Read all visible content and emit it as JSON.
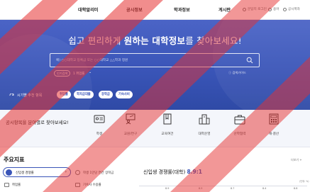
{
  "nav": {
    "items": [
      "대학알리미",
      "공시정보",
      "학과정보",
      "게시판"
    ],
    "utils": [
      "문답지 로그인",
      "용어",
      "공시목차"
    ]
  },
  "hero": {
    "title_pre": "쉽고 편리하게 ",
    "title_bold": "원하는 대학정보",
    "title_post": "를 찾아보세요!",
    "search_placeholder": "예) ○○대학교 등록금 또는 ○○대학교 △△학과 정원",
    "popular_label": "인기검색",
    "popular_rank": "1 취업률",
    "search_guide": "검색가이드",
    "recent_label": "시기별 추천 항목",
    "chips": [
      "취업률",
      "학자금대출",
      "장학금",
      "기숙사비"
    ]
  },
  "categories": {
    "prompt": "공시항목을 분야별로 찾아보세요!",
    "items": [
      "학생",
      "교원/연구",
      "교육여건",
      "대학운영",
      "산학협력",
      "재·결산"
    ]
  },
  "indicators": {
    "title": "주요지표",
    "more": "더보기 +",
    "selected": "신입생 경쟁률",
    "row_items": [
      "학생 1인당 연간 장학금",
      "취업률",
      "기숙사 수용률"
    ],
    "big_stat_label": "신입생 경쟁률(대학)",
    "big_stat_value": "8.9:1",
    "unit": "(단위: %)",
    "ticks": [
      "8.9",
      "8.9",
      "8.7",
      "8.4",
      "8.8"
    ]
  },
  "colors": {
    "brand": "#3a55b8",
    "hero_top": "#4b64c6",
    "watermark": "#e53030"
  }
}
